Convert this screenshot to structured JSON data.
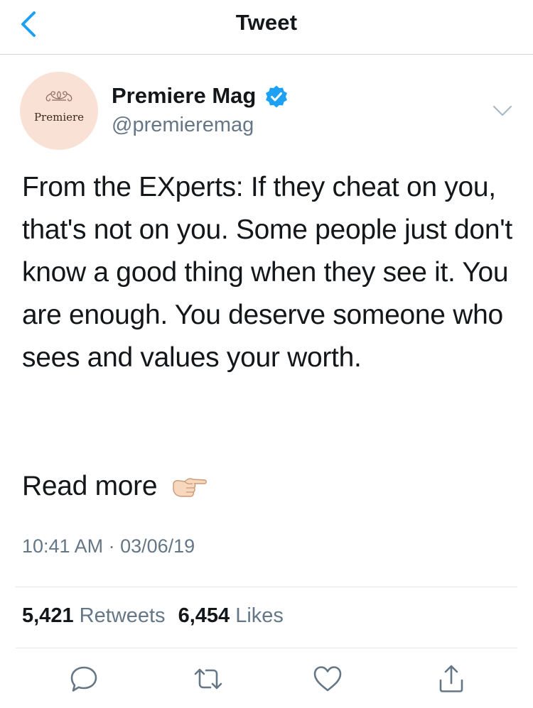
{
  "nav": {
    "title": "Tweet",
    "back_icon": "chevron-left-icon",
    "accent_color": "#1da1f2"
  },
  "tweet": {
    "author": {
      "display_name": "Premiere Mag",
      "handle": "@premieremag",
      "verified": true,
      "avatar_text": "Premiere",
      "avatar_bg": "#fae1d5"
    },
    "body": "From the EXperts: If they cheat on you, that's not on you. Some people just don't know a good thing when they see it. You are enough. You deserve someone who sees and values your worth.",
    "read_more": "Read more",
    "read_more_emoji": "pointing-right-hand-icon",
    "timestamp": "10:41 AM · 03/06/19",
    "stats": {
      "retweets_count": "5,421",
      "retweets_label": "Retweets",
      "likes_count": "6,454",
      "likes_label": "Likes"
    }
  },
  "actions": [
    {
      "name": "reply",
      "icon": "comment-icon"
    },
    {
      "name": "retweet",
      "icon": "retweet-icon"
    },
    {
      "name": "like",
      "icon": "heart-icon"
    },
    {
      "name": "share",
      "icon": "share-icon"
    }
  ],
  "colors": {
    "text_primary": "#14171a",
    "text_secondary": "#657786",
    "verified_badge": "#1da1f2",
    "divider": "#e1e6ea"
  }
}
